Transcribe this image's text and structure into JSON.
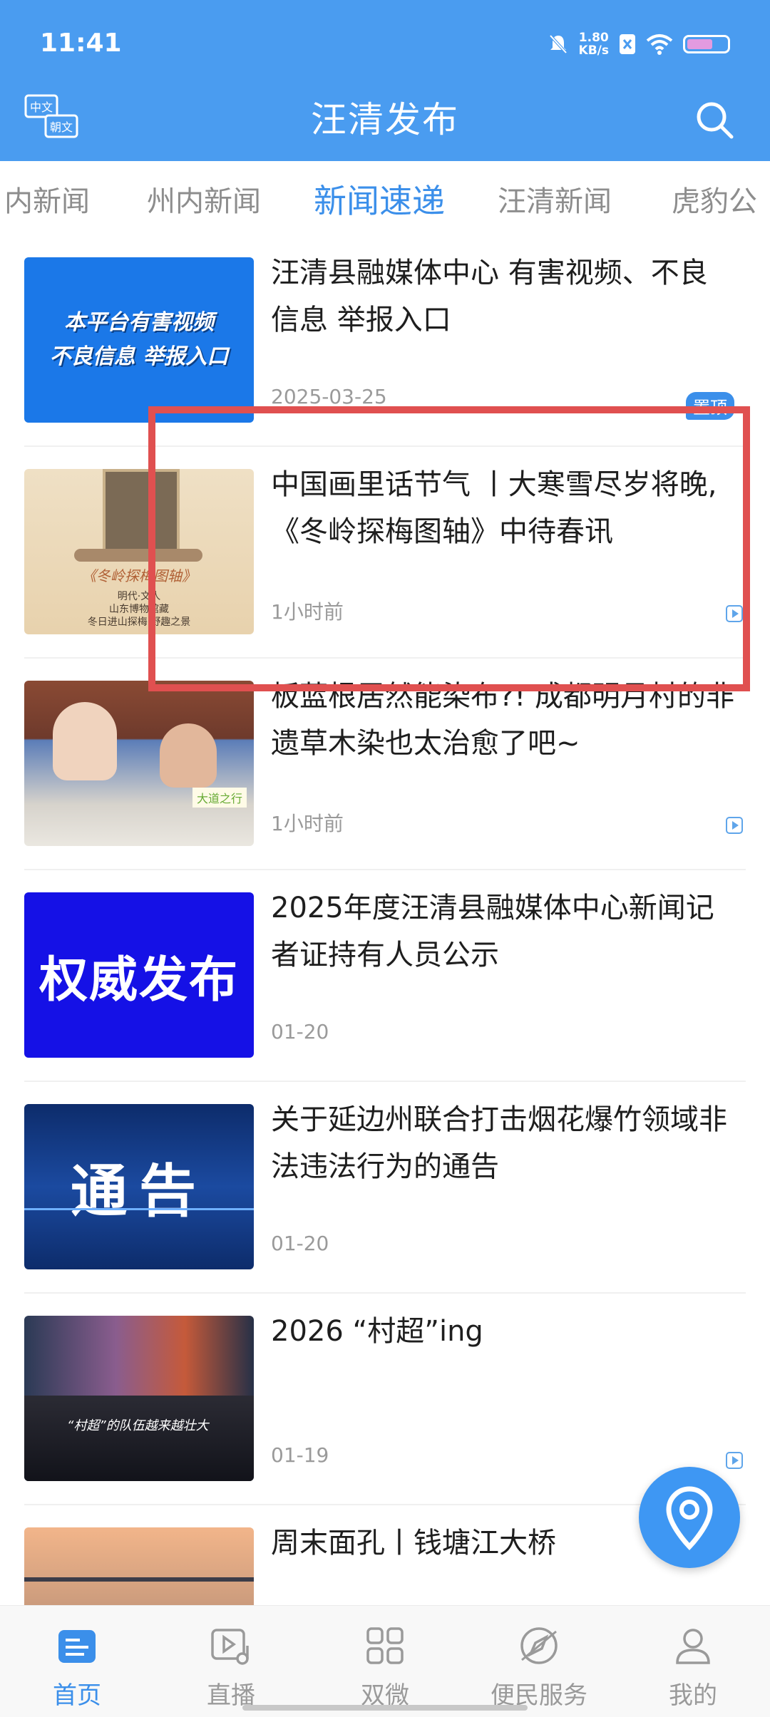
{
  "status": {
    "time": "11:41",
    "speed_value": "1.80",
    "speed_unit": "KB/s",
    "battery_level": 0.65
  },
  "header": {
    "title": "汪清发布",
    "lang_top": "中文",
    "lang_bottom": "朝文"
  },
  "tabs": [
    {
      "label": "内新闻"
    },
    {
      "label": "州内新闻"
    },
    {
      "label": "新闻速递"
    },
    {
      "label": "汪清新闻"
    },
    {
      "label": "虎豹公"
    }
  ],
  "active_tab_index": 2,
  "articles": [
    {
      "title": "汪清县融媒体中心 有害视频、不良信息 举报入口",
      "meta": "2025-03-25",
      "badge": "置顶",
      "thumb_text": [
        "本平台有害视频",
        "不良信息  举报入口"
      ]
    },
    {
      "title": "中国画里话节气 丨大寒雪尽岁将晚,《冬岭探梅图轴》中待春讯",
      "meta": "1小时前",
      "thumb_text": [
        "《冬岭探梅图轴》",
        "明代·文人",
        "山东博物馆藏",
        "冬日进山探梅 野趣之景"
      ]
    },
    {
      "title": "板蓝根居然能染布?! 成都明月村的非遗草木染也太治愈了吧~",
      "meta": "1小时前",
      "thumb_text": [
        "大道之行"
      ]
    },
    {
      "title": "2025年度汪清县融媒体中心新闻记者证持有人员公示",
      "meta": "01-20",
      "thumb_text": [
        "权威发布"
      ]
    },
    {
      "title": "关于延边州联合打击烟花爆竹领域非法违法行为的通告",
      "meta": "01-20",
      "thumb_text": [
        "通告"
      ]
    },
    {
      "title": "2026 “村超”ing",
      "meta": "01-19",
      "thumb_text": [
        "“村超”的队伍越来越壮大"
      ]
    },
    {
      "title": "周末面孔丨钱塘江大桥",
      "meta": ""
    }
  ],
  "bottom_nav": [
    {
      "label": "首页",
      "icon": "news-icon"
    },
    {
      "label": "直播",
      "icon": "live-play-icon"
    },
    {
      "label": "双微",
      "icon": "grid-icon"
    },
    {
      "label": "便民服务",
      "icon": "compass-icon"
    },
    {
      "label": "我的",
      "icon": "user-icon"
    }
  ],
  "colors": {
    "brand": "#4a9cf0",
    "accent": "#3b8fea",
    "highlight": "#e05050"
  }
}
